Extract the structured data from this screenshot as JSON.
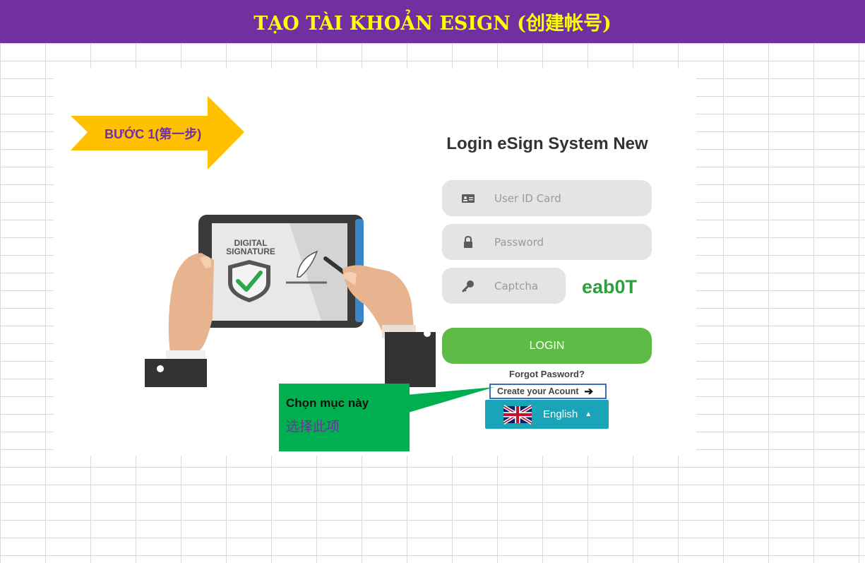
{
  "header": {
    "title": "TẠO TÀI KHOẢN ESIGN (创建帐号)"
  },
  "step": {
    "label": "BƯỚC 1(第一步)"
  },
  "illustration": {
    "sign_text_line1": "DIGITAL",
    "sign_text_line2": "SIGNATURE"
  },
  "login": {
    "title": "Login eSign System New",
    "user_placeholder": "User ID Card",
    "password_placeholder": "Password",
    "captcha_placeholder": "Captcha",
    "captcha_code": "eab0T",
    "login_label": "LOGIN",
    "forgot_label": "Forgot Pasword?",
    "create_label": "Create your Acount",
    "create_arrow": "➔",
    "language_label": "English",
    "language_caret": "▲"
  },
  "callout": {
    "vi": "Chọn mục này",
    "zh": "选择此项"
  },
  "colors": {
    "header_bg": "#7030a0",
    "header_text": "#ffff00",
    "arrow": "#ffc000",
    "login_button": "#5dbb46",
    "language_button": "#1aa4b8",
    "callout": "#00b050",
    "highlight_border": "#3b6bbf",
    "captcha_text": "#2e9e3e"
  },
  "icons": {
    "user": "id-card-icon",
    "password": "lock-icon",
    "captcha": "key-icon",
    "flag": "uk-flag-icon",
    "create_arrow": "arrow-right-icon",
    "language_caret": "caret-up-icon"
  }
}
